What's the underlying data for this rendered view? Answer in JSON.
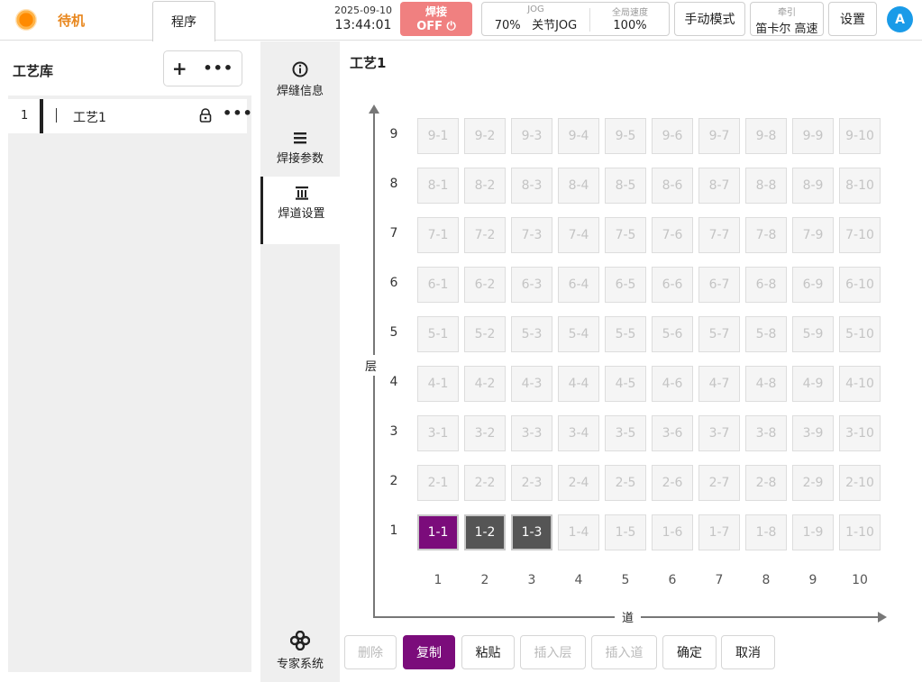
{
  "header": {
    "status": "待机",
    "program_tab": "程序",
    "date": "2025-09-10",
    "time": "13:44:01",
    "weld_label": "焊接",
    "weld_state": "OFF ⏻",
    "jog_caption": "JOG",
    "jog_percent": "70%",
    "jog_mode": "关节JOG",
    "global_speed_caption": "全局速度",
    "global_speed_value": "100%",
    "manual_mode": "手动模式",
    "traction_caption": "牵引",
    "traction_value": "笛卡尔 高速",
    "settings": "设置",
    "avatar_letter": "A",
    "weld_color": "#f08080"
  },
  "library": {
    "title": "工艺库",
    "add_icon": "plus-icon",
    "more_icon": "more-icon",
    "items": [
      {
        "index": "1",
        "name": "工艺1",
        "locked": true
      }
    ]
  },
  "nav": {
    "items": [
      {
        "label": "焊缝信息",
        "icon": "info-icon"
      },
      {
        "label": "焊接参数",
        "icon": "menu-icon"
      },
      {
        "label": "焊道设置",
        "icon": "layers-icon",
        "active": true
      },
      {
        "label": "专家系统",
        "icon": "flower-icon"
      }
    ]
  },
  "main": {
    "title": "工艺1",
    "y_axis_label": "层",
    "x_axis_label": "道",
    "rows": [
      "1",
      "2",
      "3",
      "4",
      "5",
      "6",
      "7",
      "8",
      "9"
    ],
    "cols": [
      "1",
      "2",
      "3",
      "4",
      "5",
      "6",
      "7",
      "8",
      "9",
      "10"
    ],
    "selected": {
      "1-1": "purple",
      "1-2": "gray",
      "1-3": "gray"
    },
    "accent_color": "#7b0c7b"
  },
  "actions": {
    "delete": "删除",
    "copy": "复制",
    "paste": "粘贴",
    "insert_layer": "插入层",
    "insert_pass": "插入道",
    "confirm": "确定",
    "cancel": "取消"
  }
}
